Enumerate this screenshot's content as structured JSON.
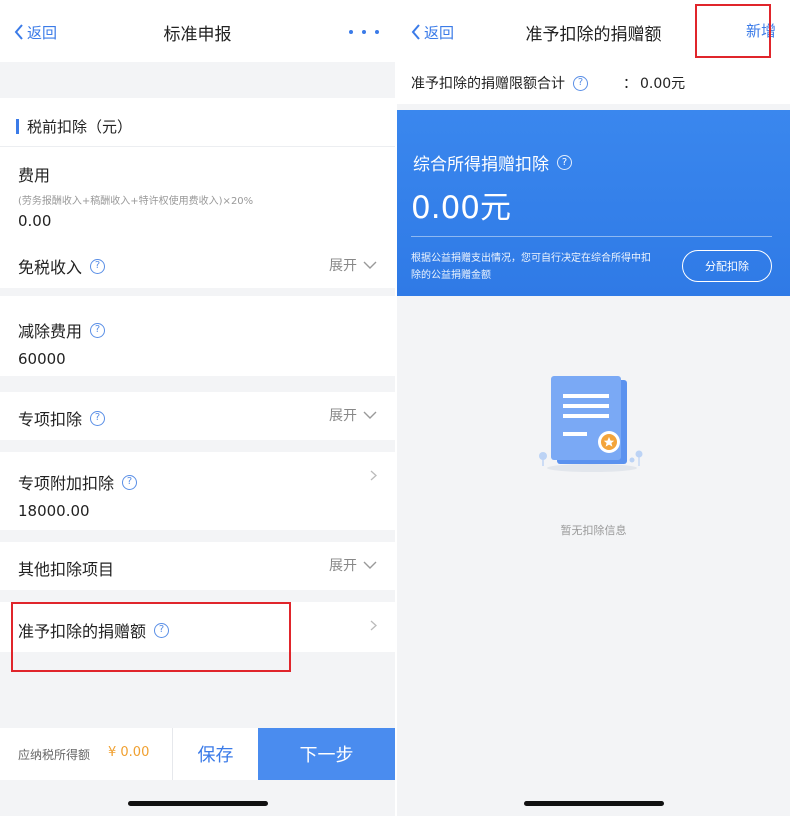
{
  "left": {
    "nav": {
      "back_label": "返回",
      "title": "标准申报"
    },
    "section_title": "税前扣除（元）",
    "fee": {
      "label": "费用",
      "formula": "(劳务报酬收入+稿酬收入+特许权使用费收入)×20%",
      "value": "0.00"
    },
    "tax_free_income": {
      "label": "免税收入",
      "expand_label": "展开"
    },
    "deduction_fee": {
      "label": "减除费用",
      "value": "60000"
    },
    "special_deduction": {
      "label": "专项扣除",
      "expand_label": "展开"
    },
    "special_additional": {
      "label": "专项附加扣除",
      "value": "18000.00"
    },
    "other_deductions": {
      "label": "其他扣除项目",
      "expand_label": "展开"
    },
    "donation": {
      "label": "准予扣除的捐赠额"
    },
    "bottom": {
      "taxable_label": "应纳税所得额",
      "taxable_value": "¥ 0.00",
      "save_label": "保存",
      "next_label": "下一步"
    }
  },
  "right": {
    "nav": {
      "back_label": "返回",
      "title": "准予扣除的捐赠额",
      "add_label": "新增"
    },
    "limit": {
      "label": "准予扣除的捐赠限额合计",
      "colon": "：",
      "value": "0.00元"
    },
    "card": {
      "title": "综合所得捐赠扣除",
      "amount": "0.00元",
      "description": "根据公益捐赠支出情况，您可自行决定在综合所得中扣除的公益捐赠金额",
      "button_label": "分配扣除"
    },
    "empty_text": "暂无扣除信息"
  },
  "colors": {
    "accent": "#3b7be8",
    "card_blue": "#3a87ee",
    "highlight_red": "#e0252b",
    "amount_orange": "#f0a030"
  },
  "icons": [
    "chevron-left-icon",
    "more-dots-icon",
    "question-icon",
    "chevron-down-icon",
    "chevron-right-icon",
    "certificate-icon"
  ]
}
